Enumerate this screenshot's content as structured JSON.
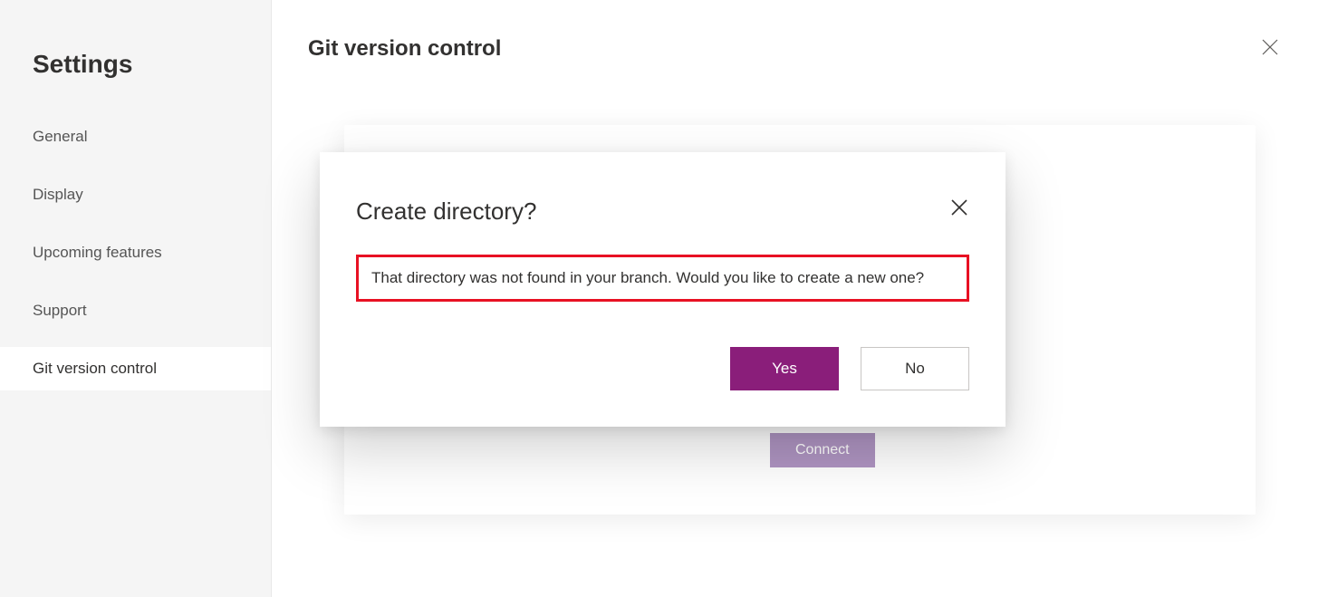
{
  "sidebar": {
    "title": "Settings",
    "items": [
      {
        "label": "General"
      },
      {
        "label": "Display"
      },
      {
        "label": "Upcoming features"
      },
      {
        "label": "Support"
      },
      {
        "label": "Git version control"
      }
    ]
  },
  "main": {
    "title": "Git version control",
    "connect_label": "Connect"
  },
  "modal": {
    "title": "Create directory?",
    "body": "That directory was not found in your branch. Would you like to create a new one?",
    "yes_label": "Yes",
    "no_label": "No"
  },
  "colors": {
    "accent": "#8a1e7a",
    "highlight_border": "#e81123"
  }
}
